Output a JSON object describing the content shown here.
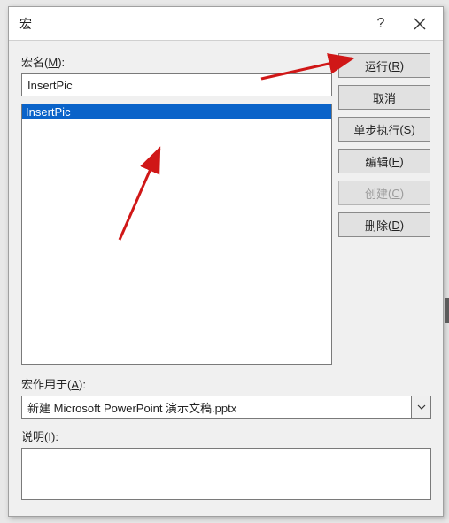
{
  "titlebar": {
    "title": "宏",
    "help": "?"
  },
  "labels": {
    "macro_name": "宏名",
    "macro_name_mn": "M",
    "scope": "宏作用于",
    "scope_mn": "A",
    "description": "说明",
    "description_mn": "I"
  },
  "macro_name_value": "InsertPic",
  "macro_list": {
    "items": [
      "InsertPic"
    ],
    "selected_index": 0
  },
  "buttons": {
    "run": {
      "label": "运行",
      "mn": "R",
      "disabled": false
    },
    "cancel": {
      "label": "取消",
      "mn": "",
      "disabled": false
    },
    "step": {
      "label": "单步执行",
      "mn": "S",
      "disabled": false
    },
    "edit": {
      "label": "编辑",
      "mn": "E",
      "disabled": false
    },
    "create": {
      "label": "创建",
      "mn": "C",
      "disabled": true
    },
    "delete": {
      "label": "删除",
      "mn": "D",
      "disabled": false
    }
  },
  "scope_value": "新建 Microsoft PowerPoint 演示文稿.pptx",
  "description_value": ""
}
